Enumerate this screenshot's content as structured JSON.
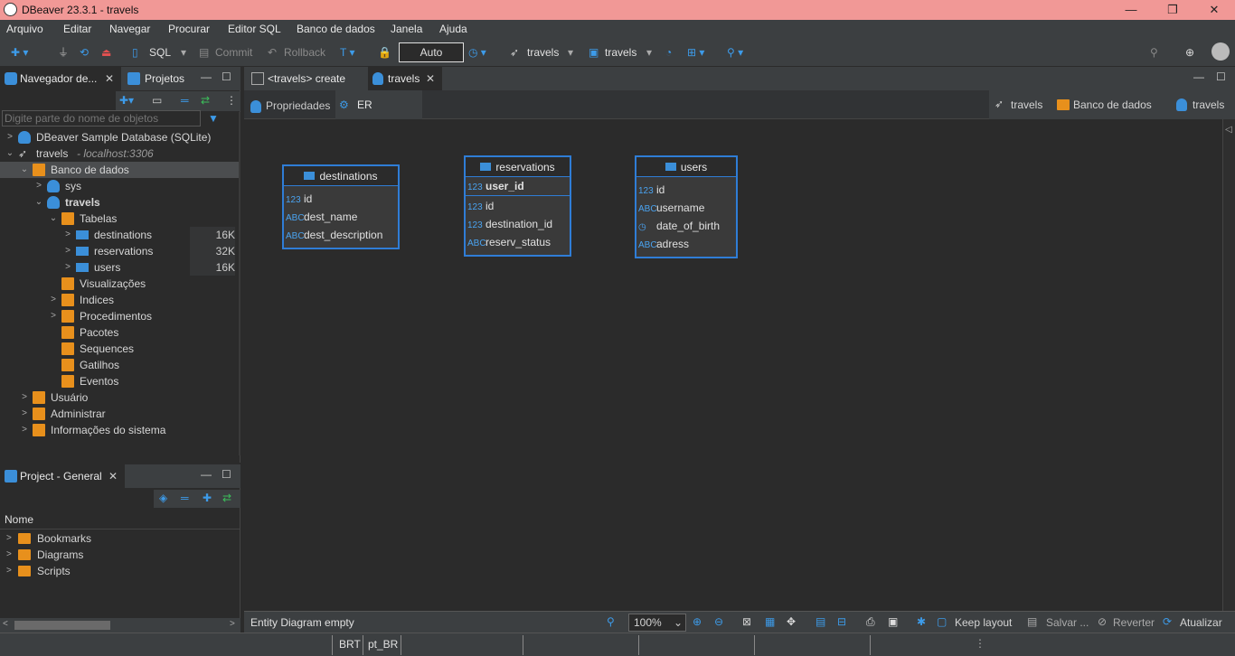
{
  "window": {
    "title": "DBeaver 23.3.1 - travels",
    "controls": [
      "—",
      "❐",
      "✕"
    ]
  },
  "menu": [
    "Arquivo",
    "Editar",
    "Navegar",
    "Procurar",
    "Editor SQL",
    "Banco de dados",
    "Janela",
    "Ajuda"
  ],
  "toolbar": {
    "sql_label": "SQL",
    "commit_label": "Commit",
    "rollback_label": "Rollback",
    "transaction_mode": "Auto",
    "datasource_label": "travels",
    "schema_label": "travels"
  },
  "navigator": {
    "tab_label": "Navegador de...",
    "projects_tab_label": "Projetos",
    "filter_placeholder": "Digite parte do nome de objetos",
    "tree": [
      {
        "label": "DBeaver Sample Database (SQLite)",
        "level": 0,
        "arrow": ">",
        "icon": "db-icon"
      },
      {
        "label": "travels",
        "sub": "- localhost:3306",
        "level": 0,
        "arrow": "v",
        "icon": "connection-icon"
      },
      {
        "label": "Banco de dados",
        "level": 1,
        "arrow": "v",
        "icon": "folder-icon",
        "selected": true
      },
      {
        "label": "sys",
        "level": 2,
        "arrow": ">",
        "icon": "db-icon"
      },
      {
        "label": "travels",
        "level": 2,
        "arrow": "v",
        "icon": "db-icon",
        "bold": true
      },
      {
        "label": "Tabelas",
        "level": 3,
        "arrow": "v",
        "icon": "table-folder-icon"
      },
      {
        "label": "destinations",
        "level": 4,
        "arrow": ">",
        "icon": "table-icon",
        "size": "16K"
      },
      {
        "label": "reservations",
        "level": 4,
        "arrow": ">",
        "icon": "table-icon",
        "size": "32K"
      },
      {
        "label": "users",
        "level": 4,
        "arrow": ">",
        "icon": "table-icon",
        "size": "16K"
      },
      {
        "label": "Visualizações",
        "level": 3,
        "arrow": "",
        "icon": "view-icon"
      },
      {
        "label": "Indices",
        "level": 3,
        "arrow": ">",
        "icon": "folder-icon"
      },
      {
        "label": "Procedimentos",
        "level": 3,
        "arrow": ">",
        "icon": "folder-icon"
      },
      {
        "label": "Pacotes",
        "level": 3,
        "arrow": "",
        "icon": "folder-icon"
      },
      {
        "label": "Sequences",
        "level": 3,
        "arrow": "",
        "icon": "folder-icon"
      },
      {
        "label": "Gatilhos",
        "level": 3,
        "arrow": "",
        "icon": "folder-icon"
      },
      {
        "label": "Eventos",
        "level": 3,
        "arrow": "",
        "icon": "folder-icon"
      },
      {
        "label": "Usuário",
        "level": 1,
        "arrow": ">",
        "icon": "user-folder-icon"
      },
      {
        "label": "Administrar",
        "level": 1,
        "arrow": ">",
        "icon": "admin-folder-icon"
      },
      {
        "label": "Informações do sistema",
        "level": 1,
        "arrow": ">",
        "icon": "info-folder-icon"
      }
    ]
  },
  "project_panel": {
    "tab_label": "Project - General",
    "column_header": "Nome",
    "items": [
      "Bookmarks",
      "Diagrams",
      "Scripts"
    ]
  },
  "editor": {
    "tabs": [
      {
        "label": "<travels> create",
        "active": false
      },
      {
        "label": "travels",
        "active": true
      }
    ],
    "subtabs": [
      {
        "label": "Propriedades",
        "active": false
      },
      {
        "label": "ER Diagrama",
        "active": true
      }
    ],
    "breadcrumbs": [
      "travels",
      "Banco de dados",
      "travels"
    ]
  },
  "diagram": {
    "entities": [
      {
        "name": "destinations",
        "key_columns": [],
        "columns": [
          {
            "type": "123",
            "name": "id"
          },
          {
            "type": "ABC",
            "name": "dest_name"
          },
          {
            "type": "ABC",
            "name": "dest_description"
          }
        ]
      },
      {
        "name": "reservations",
        "key_columns": [
          {
            "type": "123",
            "name": "user_id"
          }
        ],
        "columns": [
          {
            "type": "123",
            "name": "id"
          },
          {
            "type": "123",
            "name": "destination_id"
          },
          {
            "type": "ABC",
            "name": "reserv_status"
          }
        ]
      },
      {
        "name": "users",
        "key_columns": [],
        "columns": [
          {
            "type": "123",
            "name": "id"
          },
          {
            "type": "ABC",
            "name": "username"
          },
          {
            "type": "CLK",
            "name": "date_of_birth"
          },
          {
            "type": "ABC",
            "name": "adress"
          }
        ]
      }
    ]
  },
  "diagram_toolbar": {
    "status": "Entity Diagram  empty",
    "zoom": "100%",
    "keep_layout": "Keep layout",
    "save": "Salvar ...",
    "revert": "Reverter",
    "refresh": "Atualizar"
  },
  "statusbar": {
    "timezone": "BRT",
    "locale": "pt_BR"
  }
}
